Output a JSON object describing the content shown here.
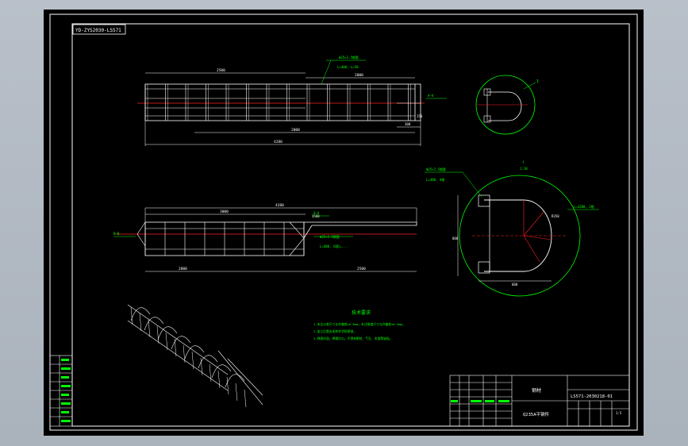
{
  "colors": {
    "background": "#000000",
    "outside": "#b3bac3",
    "border": "#ffffff",
    "annotation": "#00ff00",
    "centerline": "#ff2020",
    "dimension": "#ffffff"
  },
  "stamp": "YD-ZYS2030-LS571",
  "sheet": {
    "material": "钢材",
    "part_name": "Q235A平钢件",
    "drawing_no": "LS571-2030218-01",
    "scale": "1:5"
  },
  "tech_req": {
    "title": "技术要求",
    "lines": [
      "1.未注公差尺寸允许偏差±0.5mm，未注角度尺寸允许偏差±0.5mm。",
      "2.加工后需去毛刺并涂防锈漆。",
      "3.焊接牢固，焊缝均匀，不得有裂纹、气孔、夹渣等缺陷。"
    ]
  },
  "top_view": {
    "dims": {
      "overall": "4280",
      "left": "2500",
      "mid": "2000",
      "right": "300",
      "gap": "150",
      "bottom": "2000"
    },
    "notes": [
      "Φ25×2.5钢管",
      "L=400, L=50"
    ],
    "section_a": "A—A"
  },
  "front_view": {
    "dims": {
      "overall": "4280",
      "left": "3000",
      "right": "1500",
      "bottom_left": "2000",
      "bottom_right": "2500"
    },
    "notes": [
      "Φ25×2.5钢管",
      "L=400, 间距=..."
    ],
    "section_a": "A—A",
    "section_b": "B—B"
  },
  "section_small": {
    "label": "1"
  },
  "section_large": {
    "title": "Ⅰ",
    "subtitle": "1:10",
    "note1": "Φ25×2.5钢管",
    "note2": "L=400, 4根",
    "note3": "L=4280, 2根",
    "dim_height": "800",
    "dim_width": "600",
    "dim_r": "R350"
  }
}
